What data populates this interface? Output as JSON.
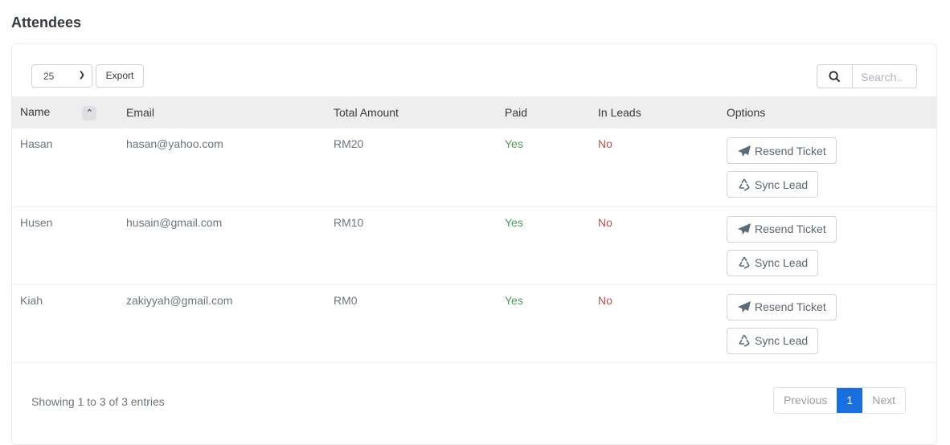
{
  "page": {
    "title": "Attendees"
  },
  "toolbar": {
    "page_size": "25",
    "export_label": "Export",
    "search_placeholder": "Search.."
  },
  "table": {
    "headers": [
      "Name",
      "Email",
      "Total Amount",
      "Paid",
      "In Leads",
      "Options"
    ],
    "rows": [
      {
        "name": "Hasan",
        "email": "hasan@yahoo.com",
        "total": "RM20",
        "paid": "Yes",
        "in_leads": "No"
      },
      {
        "name": "Husen",
        "email": "husain@gmail.com",
        "total": "RM10",
        "paid": "Yes",
        "in_leads": "No"
      },
      {
        "name": "Kiah",
        "email": "zakiyyah@gmail.com",
        "total": "RM0",
        "paid": "Yes",
        "in_leads": "No"
      }
    ],
    "actions": {
      "resend": "Resend Ticket",
      "sync": "Sync Lead"
    }
  },
  "footer": {
    "info": "Showing 1 to 3 of 3 entries",
    "previous": "Previous",
    "current_page": "1",
    "next": "Next"
  },
  "colors": {
    "paid_yes": "#4a9c5a",
    "lead_no": "#c0504d",
    "active_page": "#1a6fe0"
  }
}
